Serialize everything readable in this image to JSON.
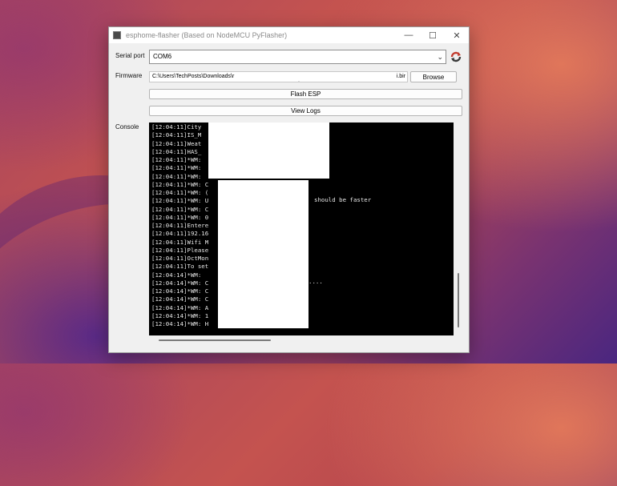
{
  "window": {
    "title": "esphome-flasher (Based on NodeMCU PyFlasher)",
    "controls": {
      "minimize": "—",
      "maximize": "☐",
      "close": "✕"
    }
  },
  "serial": {
    "label": "Serial port",
    "value": "COM6"
  },
  "firmware": {
    "label": "Firmware",
    "path": "C:\\Users\\TechPosts\\Downloads\\r",
    "suffix": "i.bir",
    "browse_label": "Browse"
  },
  "actions": {
    "flash_label": "Flash ESP",
    "logs_label": "View Logs"
  },
  "console": {
    "label": "Console",
    "lines": [
      "[12:04:11]City",
      "[12:04:11]IS_M",
      "[12:04:11]Weat",
      "[12:04:11]HAS_",
      "[12:04:11]*WM:",
      "[12:04:11]*WM:",
      "[12:04:11]*WM:",
      "[12:04:11]*WM: C",
      "[12:04:11]*WM: (",
      "[12:04:11]*WM: U",
      "[12:04:11]*WM: C",
      "[12:04:11]*WM: 0",
      "[12:04:11]Entere",
      "[12:04:11]192.16",
      "[12:04:11]Wifi M",
      "[12:04:11]Please",
      "[12:04:11]OctMon",
      "[12:04:11]To set",
      "[12:04:14]*WM:",
      "[12:04:14]*WM: C",
      "[12:04:14]*WM: C",
      "[12:04:14]*WM: C",
      "[12:04:14]*WM: A",
      "[12:04:14]*WM: 1",
      "[12:04:14]*WM: H"
    ],
    "fragment_faster": "should be faster",
    "fragment_ellipsis": "...."
  },
  "colors": {
    "console_bg": "#000000",
    "console_fg": "#e8e8e8",
    "window_bg": "#f0f0f0"
  }
}
